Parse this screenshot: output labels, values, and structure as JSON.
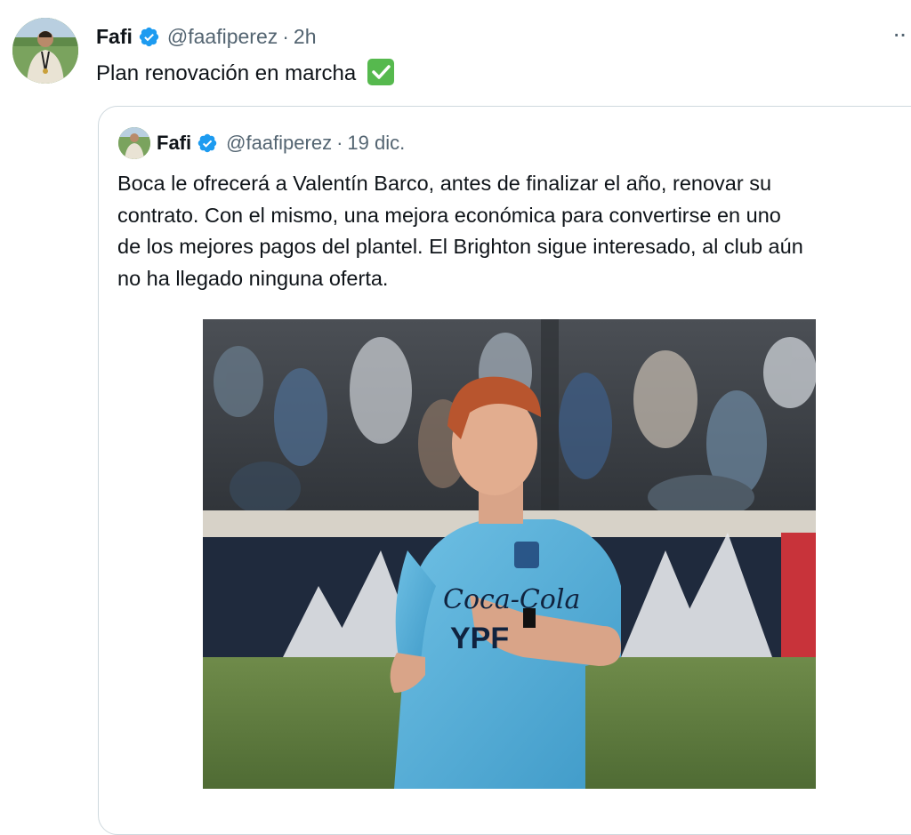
{
  "tweet": {
    "author": {
      "name": "Fafi",
      "handle": "@faafiperez",
      "verified": true,
      "avatar_icon": "profile-photo-icon"
    },
    "separator": "·",
    "time": "2h",
    "text": "Plan renovación en marcha",
    "emoji": "white-check-mark-icon",
    "more_icon": "more-options-icon",
    "more_label": "··"
  },
  "quoted": {
    "author": {
      "name": "Fafi",
      "handle": "@faafiperez",
      "verified": true
    },
    "separator": "·",
    "time": "19 dic.",
    "lines": [
      "Boca le ofrecerá a Valentín Barco, antes de finalizar el año, renovar su",
      "contrato. Con el mismo, una mejora económica para convertirse en uno",
      "de los mejores pagos del plantel. El Brighton sigue interesado, al club aún",
      "no ha llegado ninguna oferta."
    ],
    "media": {
      "kind": "photo",
      "sponsor_text": "YPF",
      "sponsor_text_2": "Coca-Cola"
    }
  },
  "colors": {
    "verified_blue": "#1d9bf0",
    "secondary_text": "#536471",
    "border": "#cfd9de",
    "check_green": "#56b94e"
  }
}
